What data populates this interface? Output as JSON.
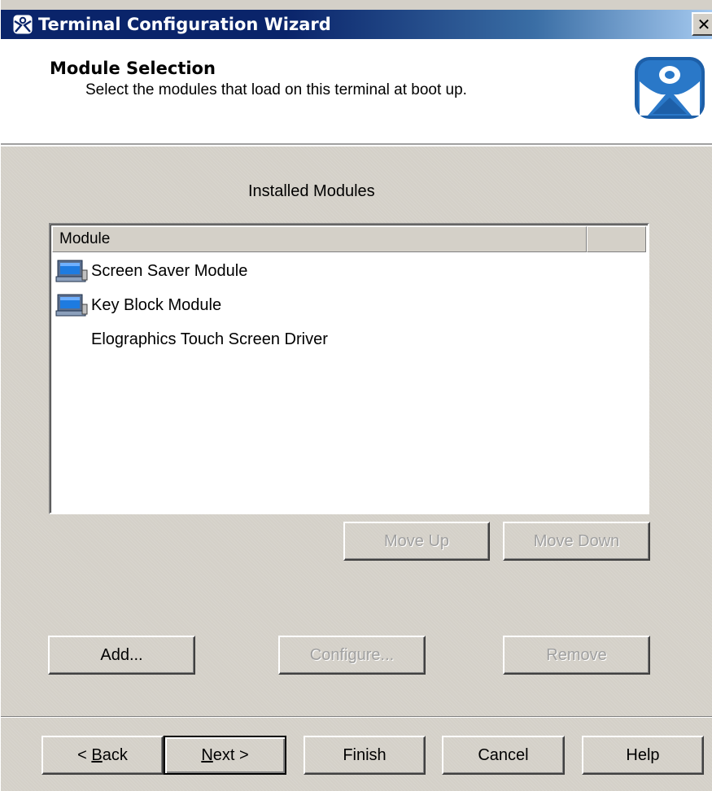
{
  "window": {
    "title": "Terminal Configuration Wizard",
    "close_label": "✕"
  },
  "header": {
    "title": "Module Selection",
    "subtitle": "Select the modules that load on this terminal at boot up."
  },
  "content": {
    "section_label": "Installed Modules",
    "list": {
      "columns": [
        "Module",
        ""
      ],
      "rows": [
        {
          "label": "Screen Saver Module",
          "icon": "computer-icon"
        },
        {
          "label": "Key Block Module",
          "icon": "computer-icon"
        },
        {
          "label": "Elographics Touch Screen Driver",
          "icon": ""
        }
      ]
    },
    "buttons": {
      "move_up": "Move Up",
      "move_down": "Move Down",
      "add": "Add...",
      "configure": "Configure...",
      "remove": "Remove"
    }
  },
  "footer": {
    "back": "< Back",
    "next": "Next >",
    "finish": "Finish",
    "cancel": "Cancel",
    "help": "Help"
  },
  "colors": {
    "title_bar": "#0a246a",
    "face": "#d4d0c8",
    "logo_blue": "#1d5fa8"
  }
}
